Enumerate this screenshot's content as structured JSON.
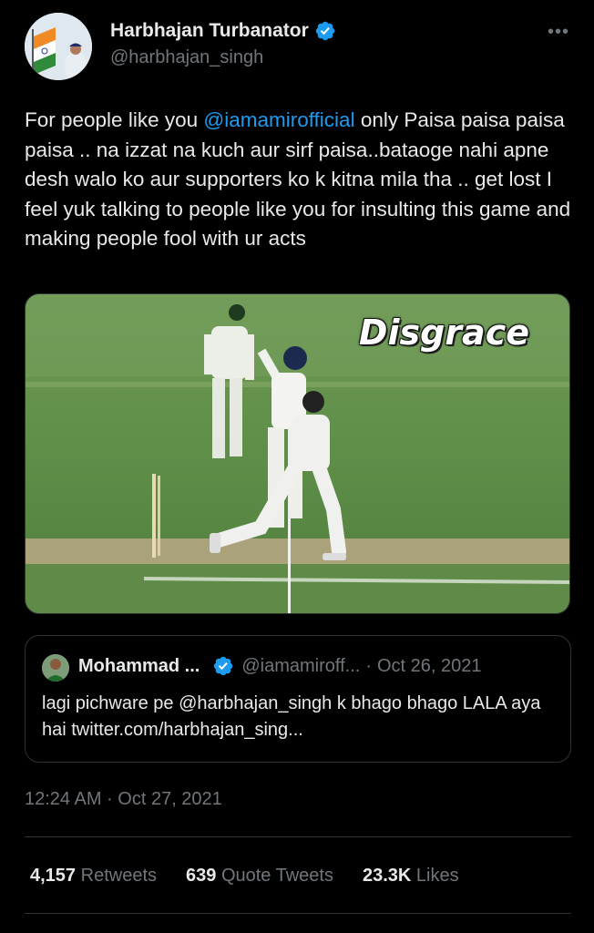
{
  "author": {
    "display_name": "Harbhajan Turbanator",
    "handle": "@harbhajan_singh"
  },
  "menu_icon": "more-horizontal-icon",
  "tweet": {
    "text_before": "For people like you ",
    "mention": "@iamamirofficial",
    "text_after": " only Paisa paisa paisa paisa .. na izzat na kuch aur sirf paisa..bataoge nahi apne desh walo ko aur supporters ko k kitna mila tha .. get lost I feel yuk talking to people like you for insulting this game and making people fool with ur acts"
  },
  "media": {
    "caption": "Disgrace"
  },
  "quoted": {
    "name": "Mohammad ...",
    "handle": "@iamamiroff...",
    "separator": "·",
    "date": "Oct 26, 2021",
    "text": "lagi pichware pe @harbhajan_singh  k bhago bhago LALA aya hai twitter.com/harbhajan_sing..."
  },
  "timestamp": "12:24 AM · Oct 27, 2021",
  "stats": {
    "retweets_count": "4,157",
    "retweets_label": "Retweets",
    "quotes_count": "639",
    "quotes_label": "Quote Tweets",
    "likes_count": "23.3K",
    "likes_label": "Likes"
  },
  "colors": {
    "background": "#000000",
    "text": "#e7e9ea",
    "secondary": "#71767b",
    "accent": "#1d9bf0",
    "border": "#2f3336"
  }
}
